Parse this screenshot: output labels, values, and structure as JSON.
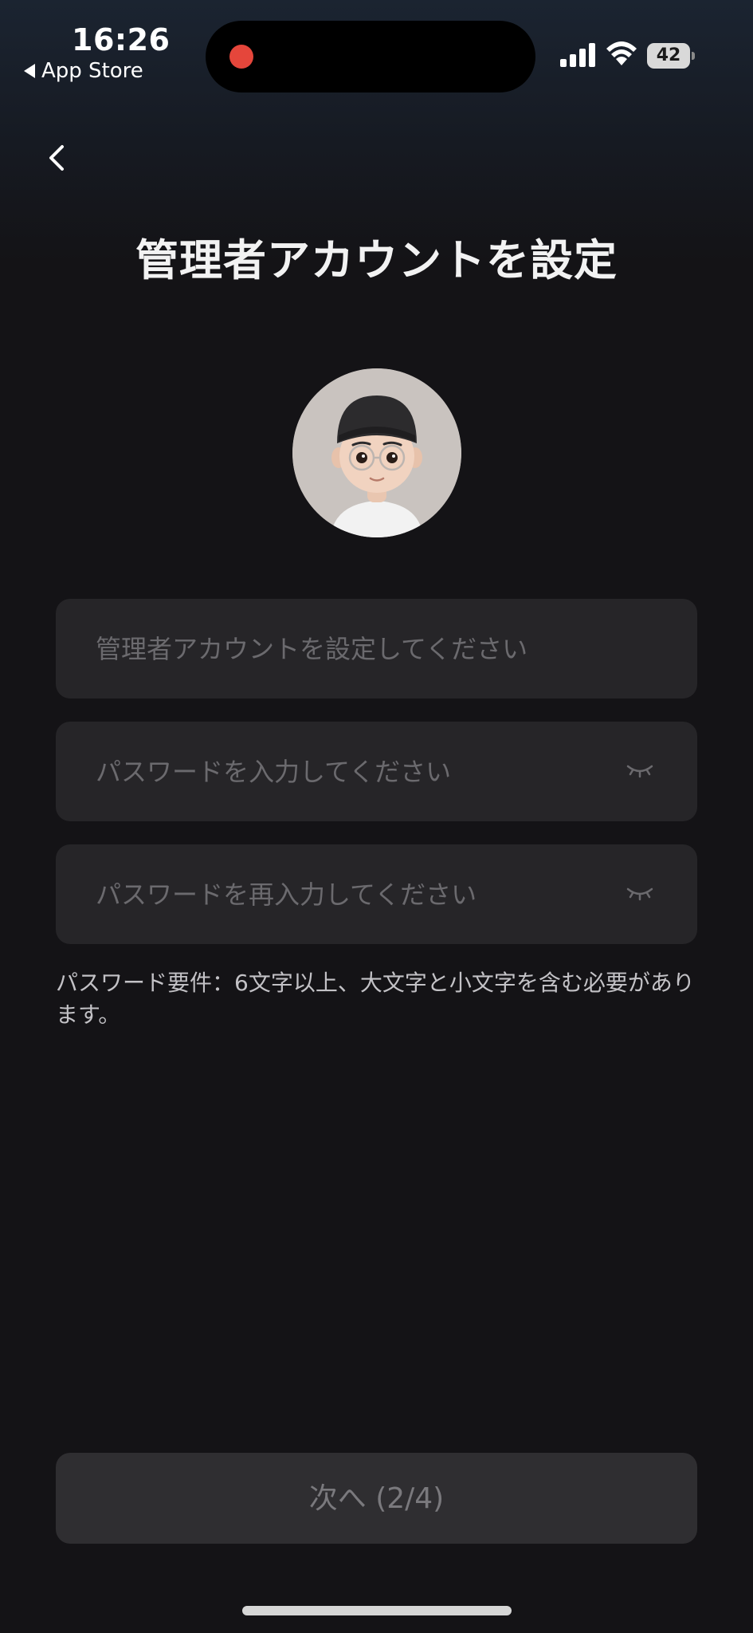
{
  "status_bar": {
    "time": "16:26",
    "back_app": "App Store",
    "battery": "42",
    "icons": [
      "cellular-signal-icon",
      "wifi-icon",
      "battery-icon"
    ]
  },
  "nav": {
    "back_icon": "chevron-left-icon"
  },
  "page": {
    "title": "管理者アカウントを設定"
  },
  "form": {
    "account_placeholder": "管理者アカウントを設定してください",
    "password_placeholder": "パスワードを入力してください",
    "confirm_placeholder": "パスワードを再入力してください",
    "password_toggle_icon": "eye-closed-icon",
    "requirement_hint": "パスワード要件：6文字以上、大文字と小文字を含む必要があります。"
  },
  "footer": {
    "next_label": "次へ (2/4)"
  },
  "colors": {
    "background": "#141316",
    "field_background": "#262528",
    "button_background": "#2f2e31",
    "recording_dot": "#e5463b"
  }
}
